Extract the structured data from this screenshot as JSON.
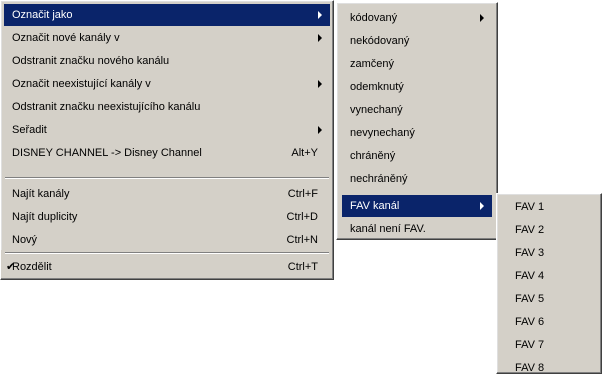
{
  "main_menu": {
    "items": [
      {
        "label": "Označit jako",
        "shortcut": ""
      },
      {
        "label": "Označit nové kanály v",
        "shortcut": ""
      },
      {
        "label": "Odstranit značku nového kanálu",
        "shortcut": ""
      },
      {
        "label": "Označit neexistující kanály v",
        "shortcut": ""
      },
      {
        "label": "Odstranit značku neexistujícího kanálu",
        "shortcut": ""
      },
      {
        "label": "Seřadit",
        "shortcut": ""
      },
      {
        "label": "DISNEY CHANNEL -> Disney Channel",
        "shortcut": "Alt+Y"
      },
      {
        "label": "Najít kanály",
        "shortcut": "Ctrl+F"
      },
      {
        "label": "Najít duplicity",
        "shortcut": "Ctrl+D"
      },
      {
        "label": "Nový",
        "shortcut": "Ctrl+N"
      },
      {
        "label": "Rozdělit",
        "shortcut": "Ctrl+T",
        "checked": true
      }
    ],
    "check_mark": "✔"
  },
  "mark_as_submenu": {
    "items": [
      {
        "label": "kódovaný"
      },
      {
        "label": "nekódovaný"
      },
      {
        "label": "zamčený"
      },
      {
        "label": "odemknutý"
      },
      {
        "label": "vynechaný"
      },
      {
        "label": "nevynechaný"
      },
      {
        "label": "chráněný"
      },
      {
        "label": "nechráněný"
      },
      {
        "label": "FAV kanál"
      },
      {
        "label": "kanál není FAV."
      }
    ]
  },
  "fav_submenu": {
    "items": [
      {
        "label": "FAV 1"
      },
      {
        "label": "FAV 2"
      },
      {
        "label": "FAV 3"
      },
      {
        "label": "FAV 4"
      },
      {
        "label": "FAV 5"
      },
      {
        "label": "FAV 6"
      },
      {
        "label": "FAV 7"
      },
      {
        "label": "FAV 8"
      }
    ]
  },
  "colors": {
    "menu_bg": "#d4d0c8",
    "highlight": "#0a246a",
    "highlight_text": "#ffffff"
  }
}
